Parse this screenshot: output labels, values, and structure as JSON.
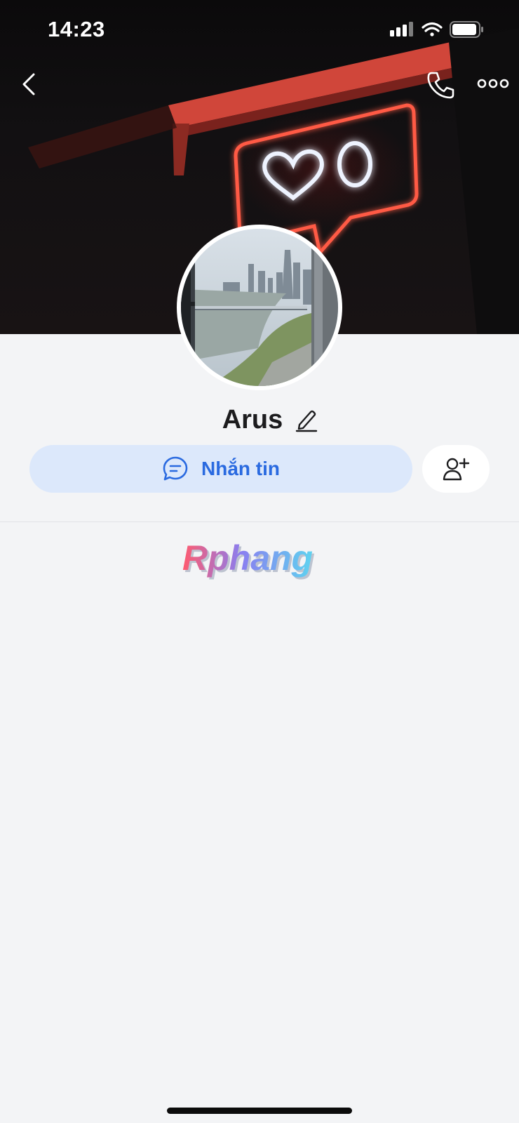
{
  "status_bar": {
    "time": "14:23",
    "icons": [
      "signal-icon",
      "wifi-icon",
      "battery-icon"
    ]
  },
  "nav": {
    "icons": [
      "back-chevron-icon",
      "phone-icon",
      "more-dots-icon"
    ]
  },
  "profile": {
    "name": "Arus",
    "edit_icon": "pencil-icon"
  },
  "actions": {
    "message_label": "Nhắn tin",
    "message_icon": "chat-bubble-icon",
    "add_friend_icon": "add-user-icon"
  },
  "watermark": {
    "text": "Rphang"
  },
  "colors": {
    "accent": "#2a6ae0",
    "message_button_bg": "#dce8fb",
    "page_bg": "#f3f4f6",
    "name": "#1c1c1e"
  }
}
